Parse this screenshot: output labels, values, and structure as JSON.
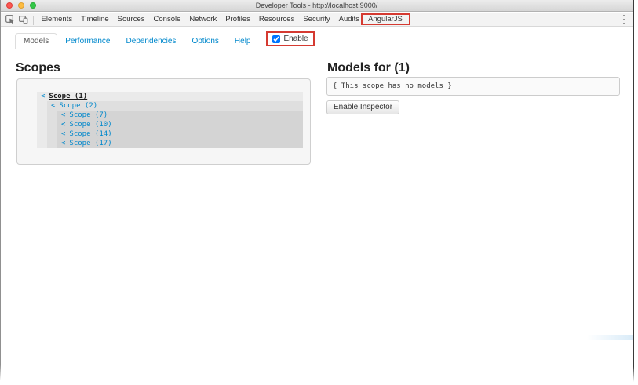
{
  "window": {
    "title": "Developer Tools - http://localhost:9000/"
  },
  "toolbar": {
    "tabs": [
      {
        "label": "Elements"
      },
      {
        "label": "Timeline"
      },
      {
        "label": "Sources"
      },
      {
        "label": "Console"
      },
      {
        "label": "Network"
      },
      {
        "label": "Profiles"
      },
      {
        "label": "Resources"
      },
      {
        "label": "Security"
      },
      {
        "label": "Audits"
      },
      {
        "label": "AngularJS",
        "active": true,
        "annotated": true
      }
    ]
  },
  "panel": {
    "tabs": [
      {
        "label": "Models",
        "active": true
      },
      {
        "label": "Performance"
      },
      {
        "label": "Dependencies"
      },
      {
        "label": "Options"
      },
      {
        "label": "Help"
      }
    ],
    "enable": {
      "label": "Enable",
      "checked_attr": "checked"
    }
  },
  "scopes": {
    "heading": "Scopes",
    "items": [
      {
        "prefix": "<",
        "label": "Scope (1)",
        "selected": true
      },
      {
        "prefix": "<",
        "label": "Scope (2)"
      },
      {
        "prefix": "<",
        "label": "Scope (7)"
      },
      {
        "prefix": "<",
        "label": "Scope (10)"
      },
      {
        "prefix": "<",
        "label": "Scope (14)"
      },
      {
        "prefix": "<",
        "label": "Scope (17)"
      }
    ]
  },
  "models": {
    "heading": "Models for (1)",
    "empty_message": "{ This scope has no models }",
    "enable_inspector_label": "Enable Inspector"
  },
  "icons": [
    "close-icon",
    "minimize-icon",
    "zoom-icon",
    "inspect-element-icon",
    "device-toolbar-icon",
    "kebab-menu-icon"
  ],
  "colors": {
    "link_blue": "#0088cc",
    "annotation_red": "#d53a31",
    "active_tab_underline": "#53a7e8",
    "traffic_close": "#fc5753",
    "traffic_minimize": "#fdbc40",
    "traffic_zoom": "#33c748"
  }
}
